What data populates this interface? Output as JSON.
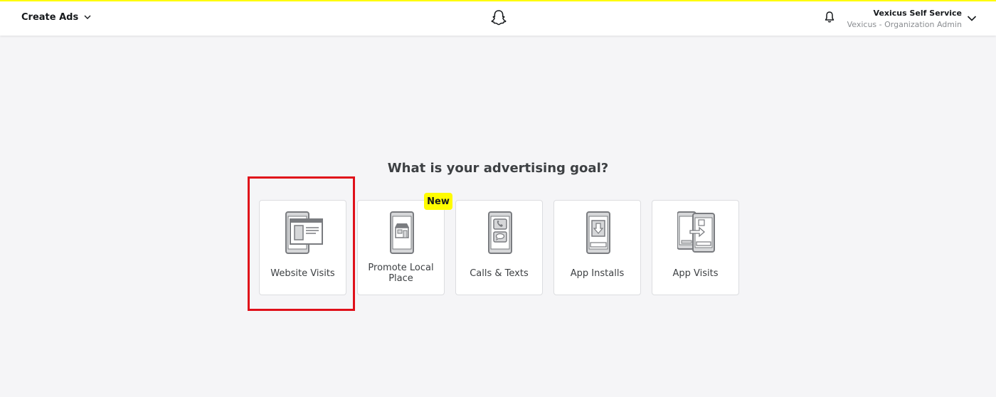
{
  "header": {
    "menu_label": "Create Ads",
    "account_name": "Vexicus Self Service",
    "account_role": "Vexicus - Organization Admin",
    "accent_color": "#fffc00"
  },
  "main": {
    "title": "What is your advertising goal?",
    "badge": "New",
    "highlight_color": "#e0101a",
    "goals": [
      {
        "label": "Website Visits",
        "icon": "website-visits-icon",
        "selected": true
      },
      {
        "label": "Promote Local Place",
        "icon": "promote-local-place-icon",
        "badge": true
      },
      {
        "label": "Calls & Texts",
        "icon": "calls-texts-icon"
      },
      {
        "label": "App Installs",
        "icon": "app-installs-icon"
      },
      {
        "label": "App Visits",
        "icon": "app-visits-icon"
      }
    ]
  }
}
